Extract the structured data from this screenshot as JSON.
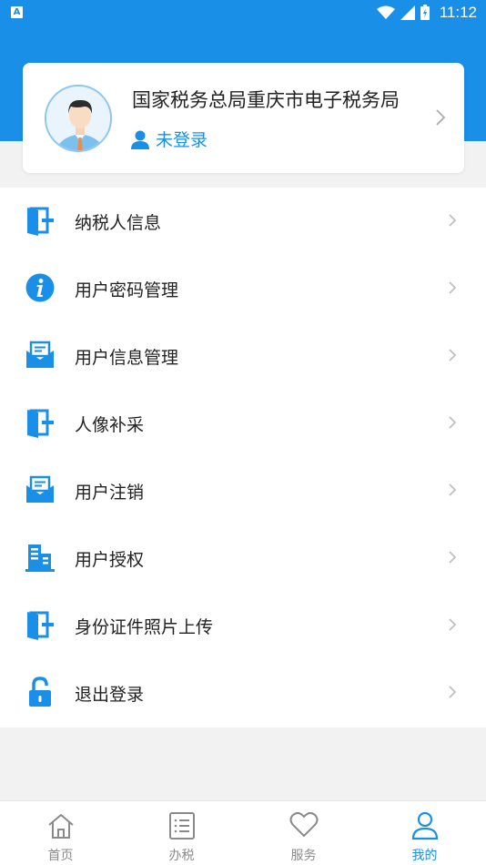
{
  "status_bar": {
    "notification_icon": "A",
    "time": "11:12"
  },
  "profile": {
    "org_name": "国家税务总局重庆市电子税务局",
    "login_status": "未登录",
    "avatar_icon": "user-avatar-icon"
  },
  "menu": {
    "items": [
      {
        "label": "纳税人信息",
        "icon": "door-icon"
      },
      {
        "label": "用户密码管理",
        "icon": "info-icon"
      },
      {
        "label": "用户信息管理",
        "icon": "mail-icon"
      },
      {
        "label": "人像补采",
        "icon": "door-icon"
      },
      {
        "label": "用户注销",
        "icon": "mail-icon"
      },
      {
        "label": "用户授权",
        "icon": "building-icon"
      },
      {
        "label": "身份证件照片上传",
        "icon": "door-icon"
      },
      {
        "label": "退出登录",
        "icon": "lock-icon"
      }
    ]
  },
  "tabbar": {
    "tabs": [
      {
        "label": "首页",
        "icon": "home-icon",
        "active": false
      },
      {
        "label": "办税",
        "icon": "list-icon",
        "active": false
      },
      {
        "label": "服务",
        "icon": "heart-icon",
        "active": false
      },
      {
        "label": "我的",
        "icon": "person-icon",
        "active": true
      }
    ]
  },
  "colors": {
    "primary": "#1a8fe8",
    "background": "#f2f2f2",
    "text": "#222222",
    "tab_inactive": "#8a8a8a"
  }
}
